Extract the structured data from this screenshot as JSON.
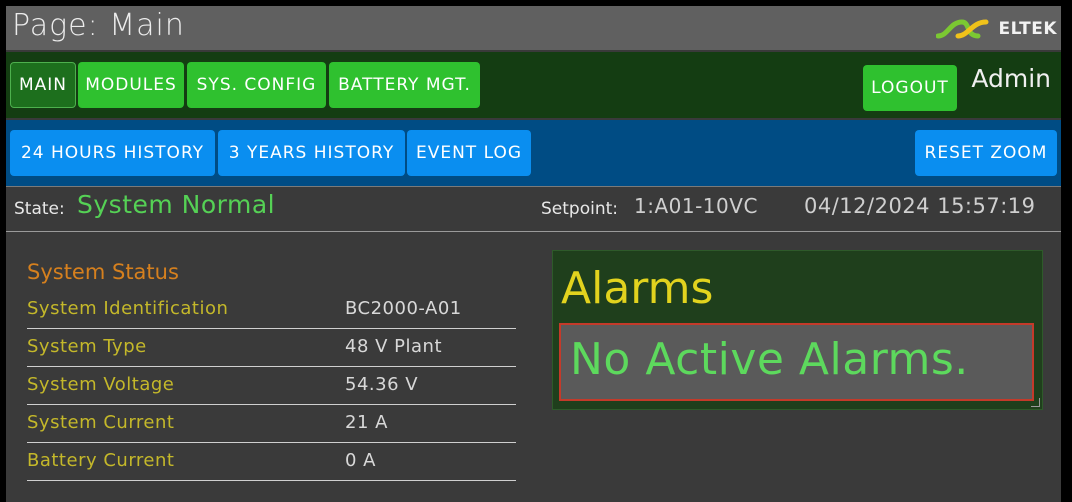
{
  "header": {
    "page_title": "Page: Main",
    "brand": "ELTEK"
  },
  "nav_primary": [
    {
      "label": "MAIN",
      "active": true
    },
    {
      "label": "MODULES"
    },
    {
      "label": "SYS. CONFIG"
    },
    {
      "label": "BATTERY MGT."
    }
  ],
  "logout_label": "LOGOUT",
  "user": "Admin",
  "nav_secondary": [
    {
      "label": "24 HOURS HISTORY"
    },
    {
      "label": "3 YEARS HISTORY"
    },
    {
      "label": "EVENT LOG"
    }
  ],
  "reset_zoom_label": "RESET ZOOM",
  "state": {
    "label": "State:",
    "value": "System Normal"
  },
  "setpoint": {
    "label": "Setpoint:",
    "value": "1:A01-10VC"
  },
  "datetime": "04/12/2024 15:57:19",
  "system_status": {
    "title": "System Status",
    "rows": [
      {
        "label": "System Identification",
        "value": "BC2000-A01"
      },
      {
        "label": "System Type",
        "value": "48 V Plant"
      },
      {
        "label": "System Voltage",
        "value": "54.36 V"
      },
      {
        "label": "System Current",
        "value": "21 A"
      },
      {
        "label": "Battery Current",
        "value": "0 A"
      }
    ]
  },
  "alarms": {
    "title": "Alarms",
    "message": "No Active Alarms."
  },
  "colors": {
    "state_green": "#55d155",
    "alarm_yellow": "#e2d31e",
    "status_orange": "#d6801e",
    "nav_green": "#2fc12f",
    "nav_blue": "#0a8ef0"
  }
}
